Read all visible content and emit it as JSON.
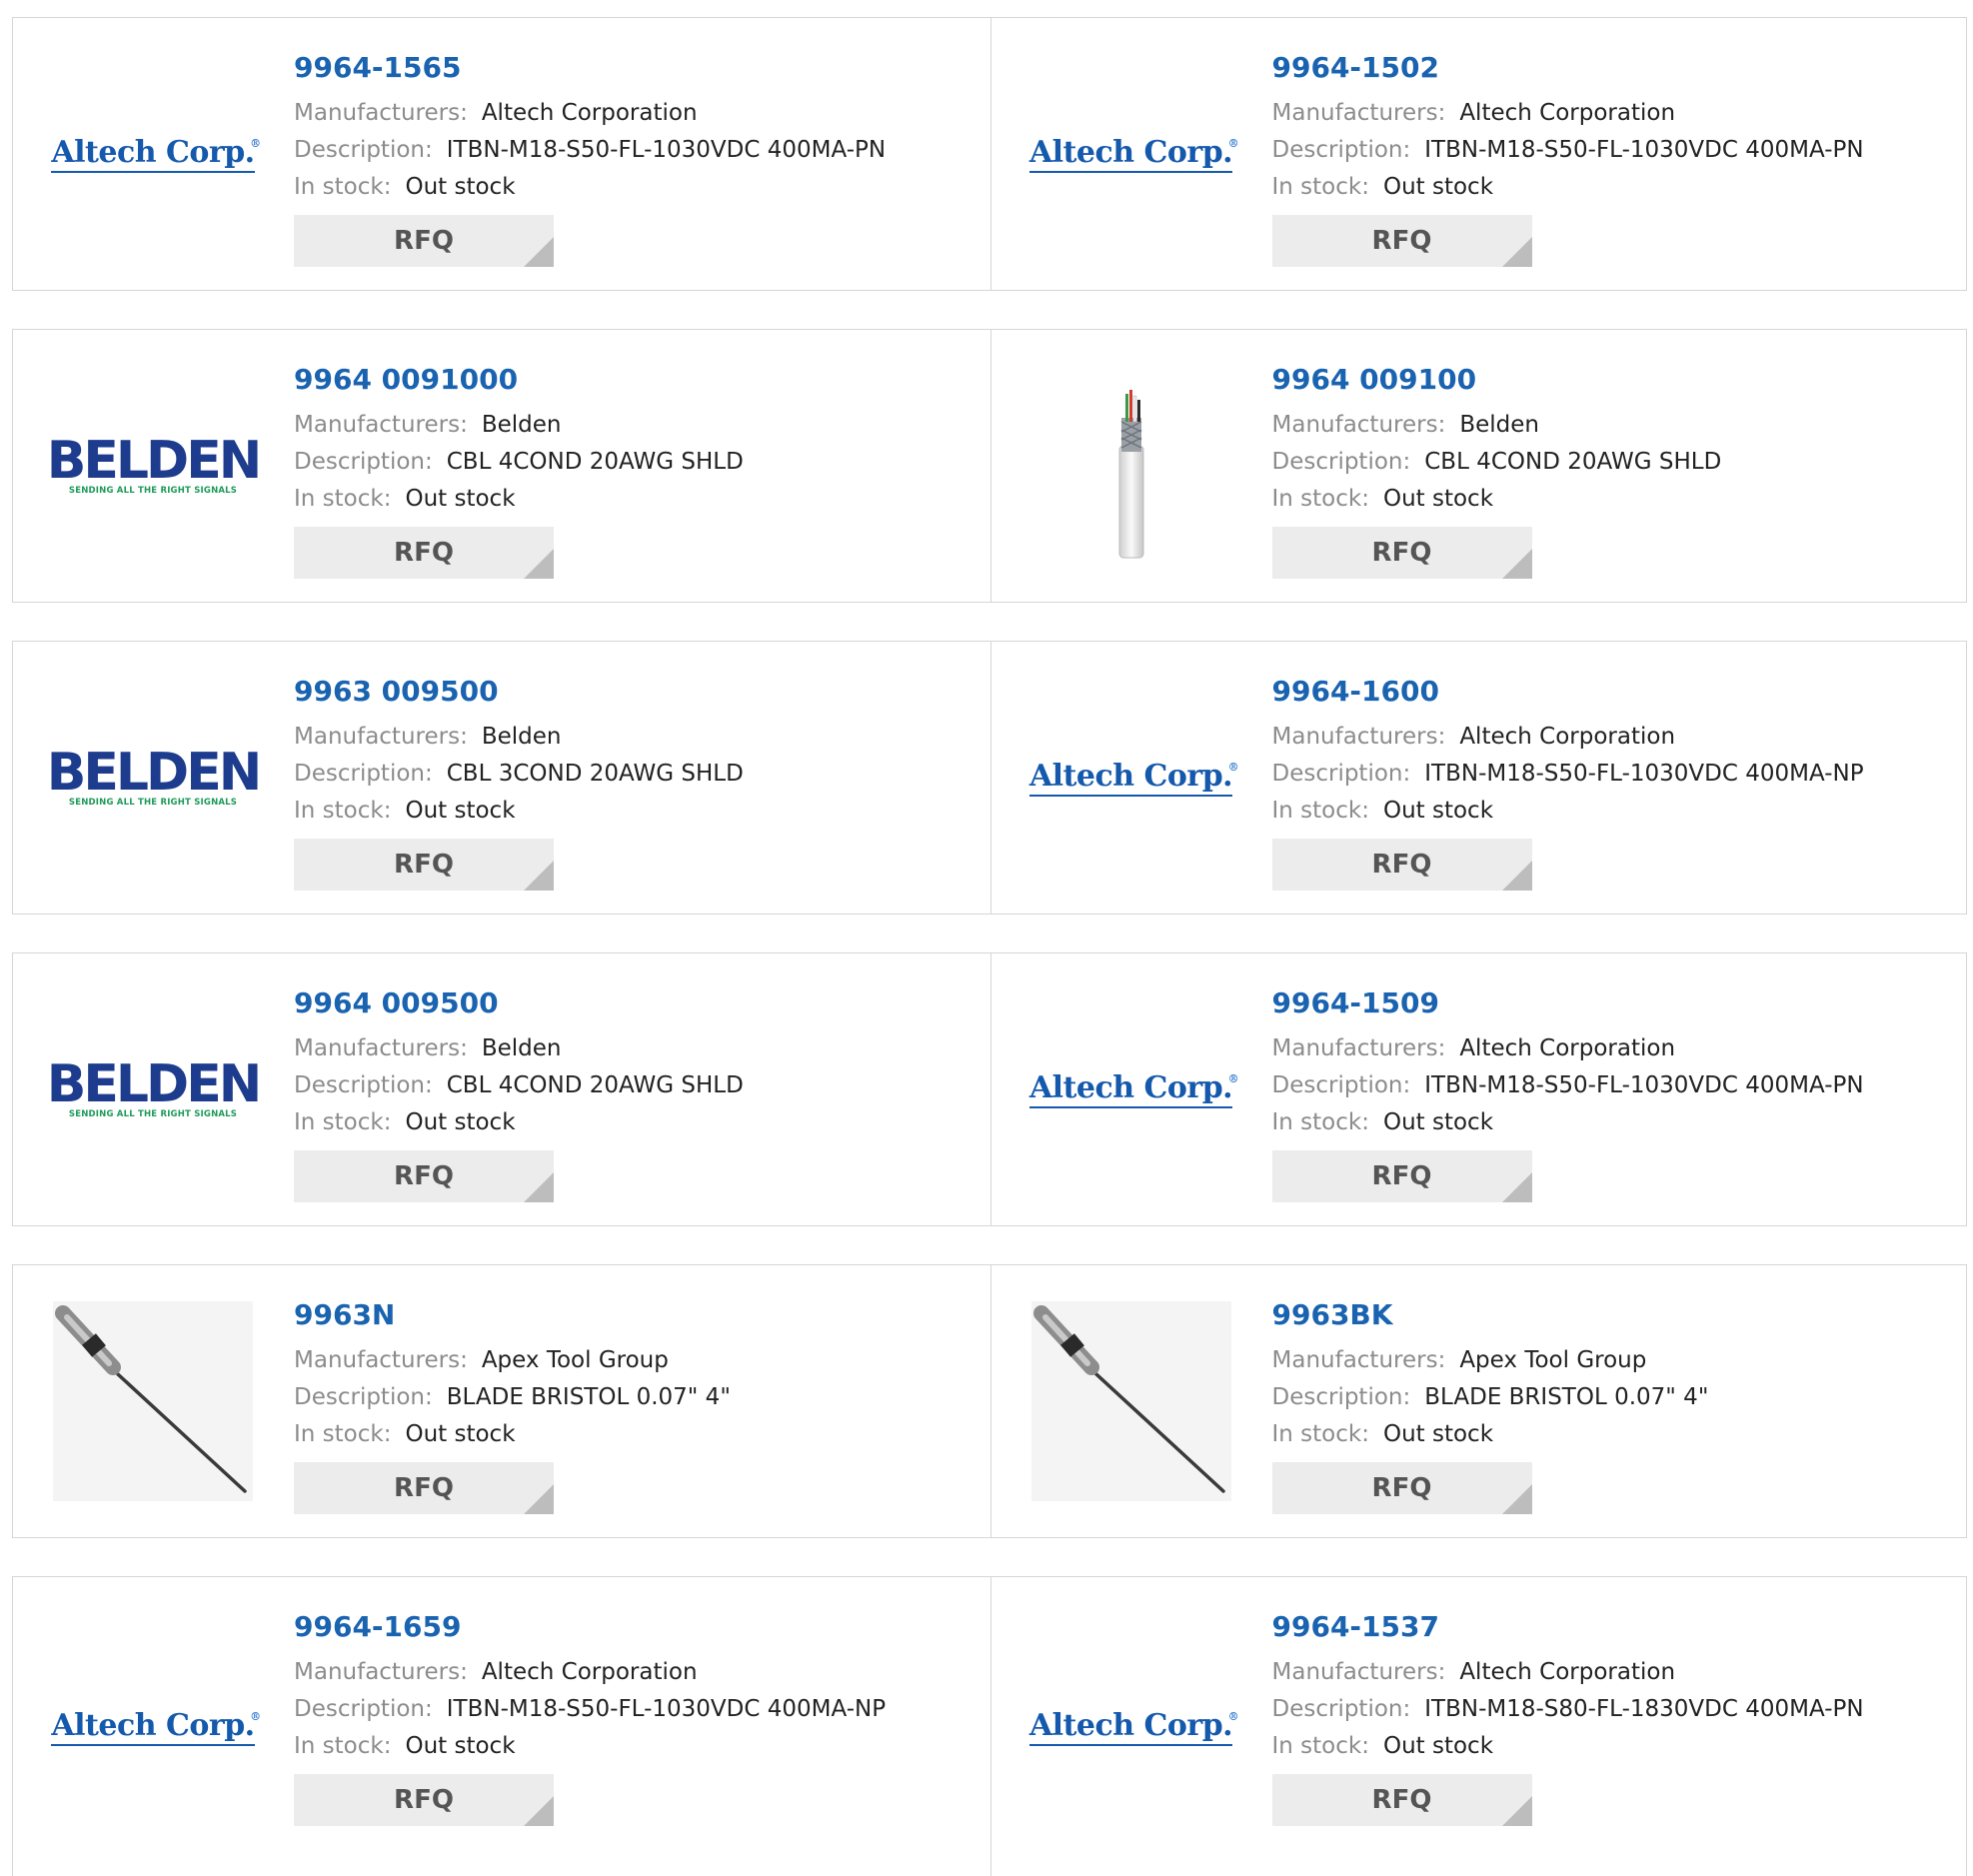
{
  "labels": {
    "manufacturers": "Manufacturers:",
    "description": "Description:",
    "in_stock": "In stock:",
    "rfq": "RFQ"
  },
  "colors": {
    "part_link": "#1a63b0",
    "label": "#8c8c8c",
    "value": "#222222",
    "rfq_bg": "#ececec",
    "border": "#d6d6d6",
    "altech_logo": "#1559ad",
    "belden_logo": "#1d3c8e",
    "belden_tagline": "#1d9a5a"
  },
  "logos": {
    "altech": {
      "text": "Altech Corp.",
      "mark": "®"
    },
    "belden": {
      "text": "BELDEN",
      "tagline": "SENDING ALL THE RIGHT SIGNALS"
    }
  },
  "products": [
    {
      "part": "9964-1565",
      "manufacturer": "Altech Corporation",
      "description": "ITBN-M18-S50-FL-1030VDC 400MA-PN",
      "stock": "Out stock",
      "image": "altech-logo"
    },
    {
      "part": "9964-1502",
      "manufacturer": "Altech Corporation",
      "description": "ITBN-M18-S50-FL-1030VDC 400MA-PN",
      "stock": "Out stock",
      "image": "altech-logo"
    },
    {
      "part": "9964 0091000",
      "manufacturer": "Belden",
      "description": "CBL 4COND 20AWG SHLD",
      "stock": "Out stock",
      "image": "belden-logo"
    },
    {
      "part": "9964 009100",
      "manufacturer": "Belden",
      "description": "CBL 4COND 20AWG SHLD",
      "stock": "Out stock",
      "image": "cable-photo"
    },
    {
      "part": "9963 009500",
      "manufacturer": "Belden",
      "description": "CBL 3COND 20AWG SHLD",
      "stock": "Out stock",
      "image": "belden-logo"
    },
    {
      "part": "9964-1600",
      "manufacturer": "Altech Corporation",
      "description": "ITBN-M18-S50-FL-1030VDC 400MA-NP",
      "stock": "Out stock",
      "image": "altech-logo"
    },
    {
      "part": "9964 009500",
      "manufacturer": "Belden",
      "description": "CBL 4COND 20AWG SHLD",
      "stock": "Out stock",
      "image": "belden-logo"
    },
    {
      "part": "9964-1509",
      "manufacturer": "Altech Corporation",
      "description": "ITBN-M18-S50-FL-1030VDC 400MA-PN",
      "stock": "Out stock",
      "image": "altech-logo"
    },
    {
      "part": "9963N",
      "manufacturer": "Apex Tool Group",
      "description": "BLADE BRISTOL 0.07\" 4\"",
      "stock": "Out stock",
      "image": "screwdriver-blade-photo"
    },
    {
      "part": "9963BK",
      "manufacturer": "Apex Tool Group",
      "description": "BLADE BRISTOL 0.07\" 4\"",
      "stock": "Out stock",
      "image": "screwdriver-blade-photo"
    },
    {
      "part": "9964-1659",
      "manufacturer": "Altech Corporation",
      "description": "ITBN-M18-S50-FL-1030VDC 400MA-NP",
      "stock": "Out stock",
      "image": "altech-logo"
    },
    {
      "part": "9964-1537",
      "manufacturer": "Altech Corporation",
      "description": "ITBN-M18-S80-FL-1830VDC 400MA-PN",
      "stock": "Out stock",
      "image": "altech-logo"
    }
  ]
}
